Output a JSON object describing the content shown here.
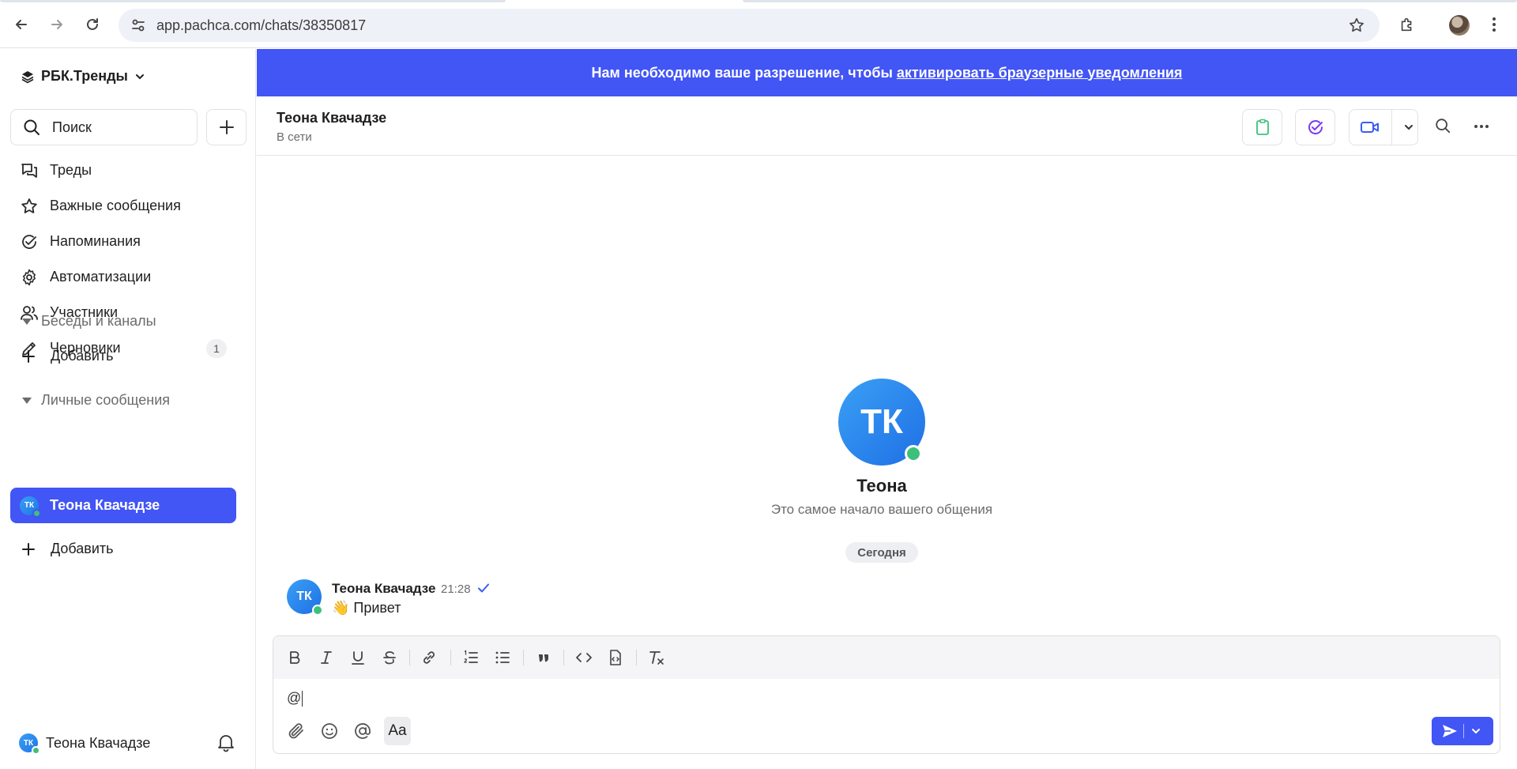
{
  "browser": {
    "url": "app.pachca.com/chats/38350817"
  },
  "sidebar": {
    "workspace_name": "РБК.Тренды",
    "search_placeholder": "Поиск",
    "nav": [
      {
        "label": "Треды",
        "icon": "threads-icon"
      },
      {
        "label": "Важные сообщения",
        "icon": "star-icon"
      },
      {
        "label": "Напоминания",
        "icon": "check-circle-icon"
      },
      {
        "label": "Автоматизации",
        "icon": "gear-icon"
      },
      {
        "label": "Участники",
        "icon": "users-icon"
      },
      {
        "label": "Черновики",
        "icon": "pencil-icon",
        "badge": "1"
      }
    ],
    "sections": {
      "channels": {
        "label": "Беседы и каналы",
        "add_label": "Добавить"
      },
      "direct": {
        "label": "Личные сообщения",
        "add_label": "Добавить"
      }
    },
    "active_dm": {
      "name": "Теона Квачадзе",
      "initials": "ТК"
    },
    "footer_user": {
      "name": "Теона Квачадзе",
      "initials": "ТК"
    }
  },
  "banner": {
    "text": "Нам необходимо ваше разрешение, чтобы",
    "link": "активировать браузерные уведомления",
    "color": "#4255f5"
  },
  "chat": {
    "title": "Теона Квачадзе",
    "status": "В сети",
    "start_initials": "ТК",
    "start_name": "Теона",
    "start_subtitle": "Это самое начало вашего общения",
    "date_label": "Сегодня",
    "messages": [
      {
        "author": "Теона Квачадзе",
        "initials": "ТК",
        "time": "21:28",
        "text": "👋 Привет"
      }
    ]
  },
  "composer": {
    "input_value": "@",
    "aa_label": "Aa"
  },
  "colors": {
    "accent": "#4255f5",
    "online": "#3ec07a",
    "clipboard": "#3ec07a",
    "check_purple": "#7a3cf0",
    "video": "#3a5cf5"
  }
}
